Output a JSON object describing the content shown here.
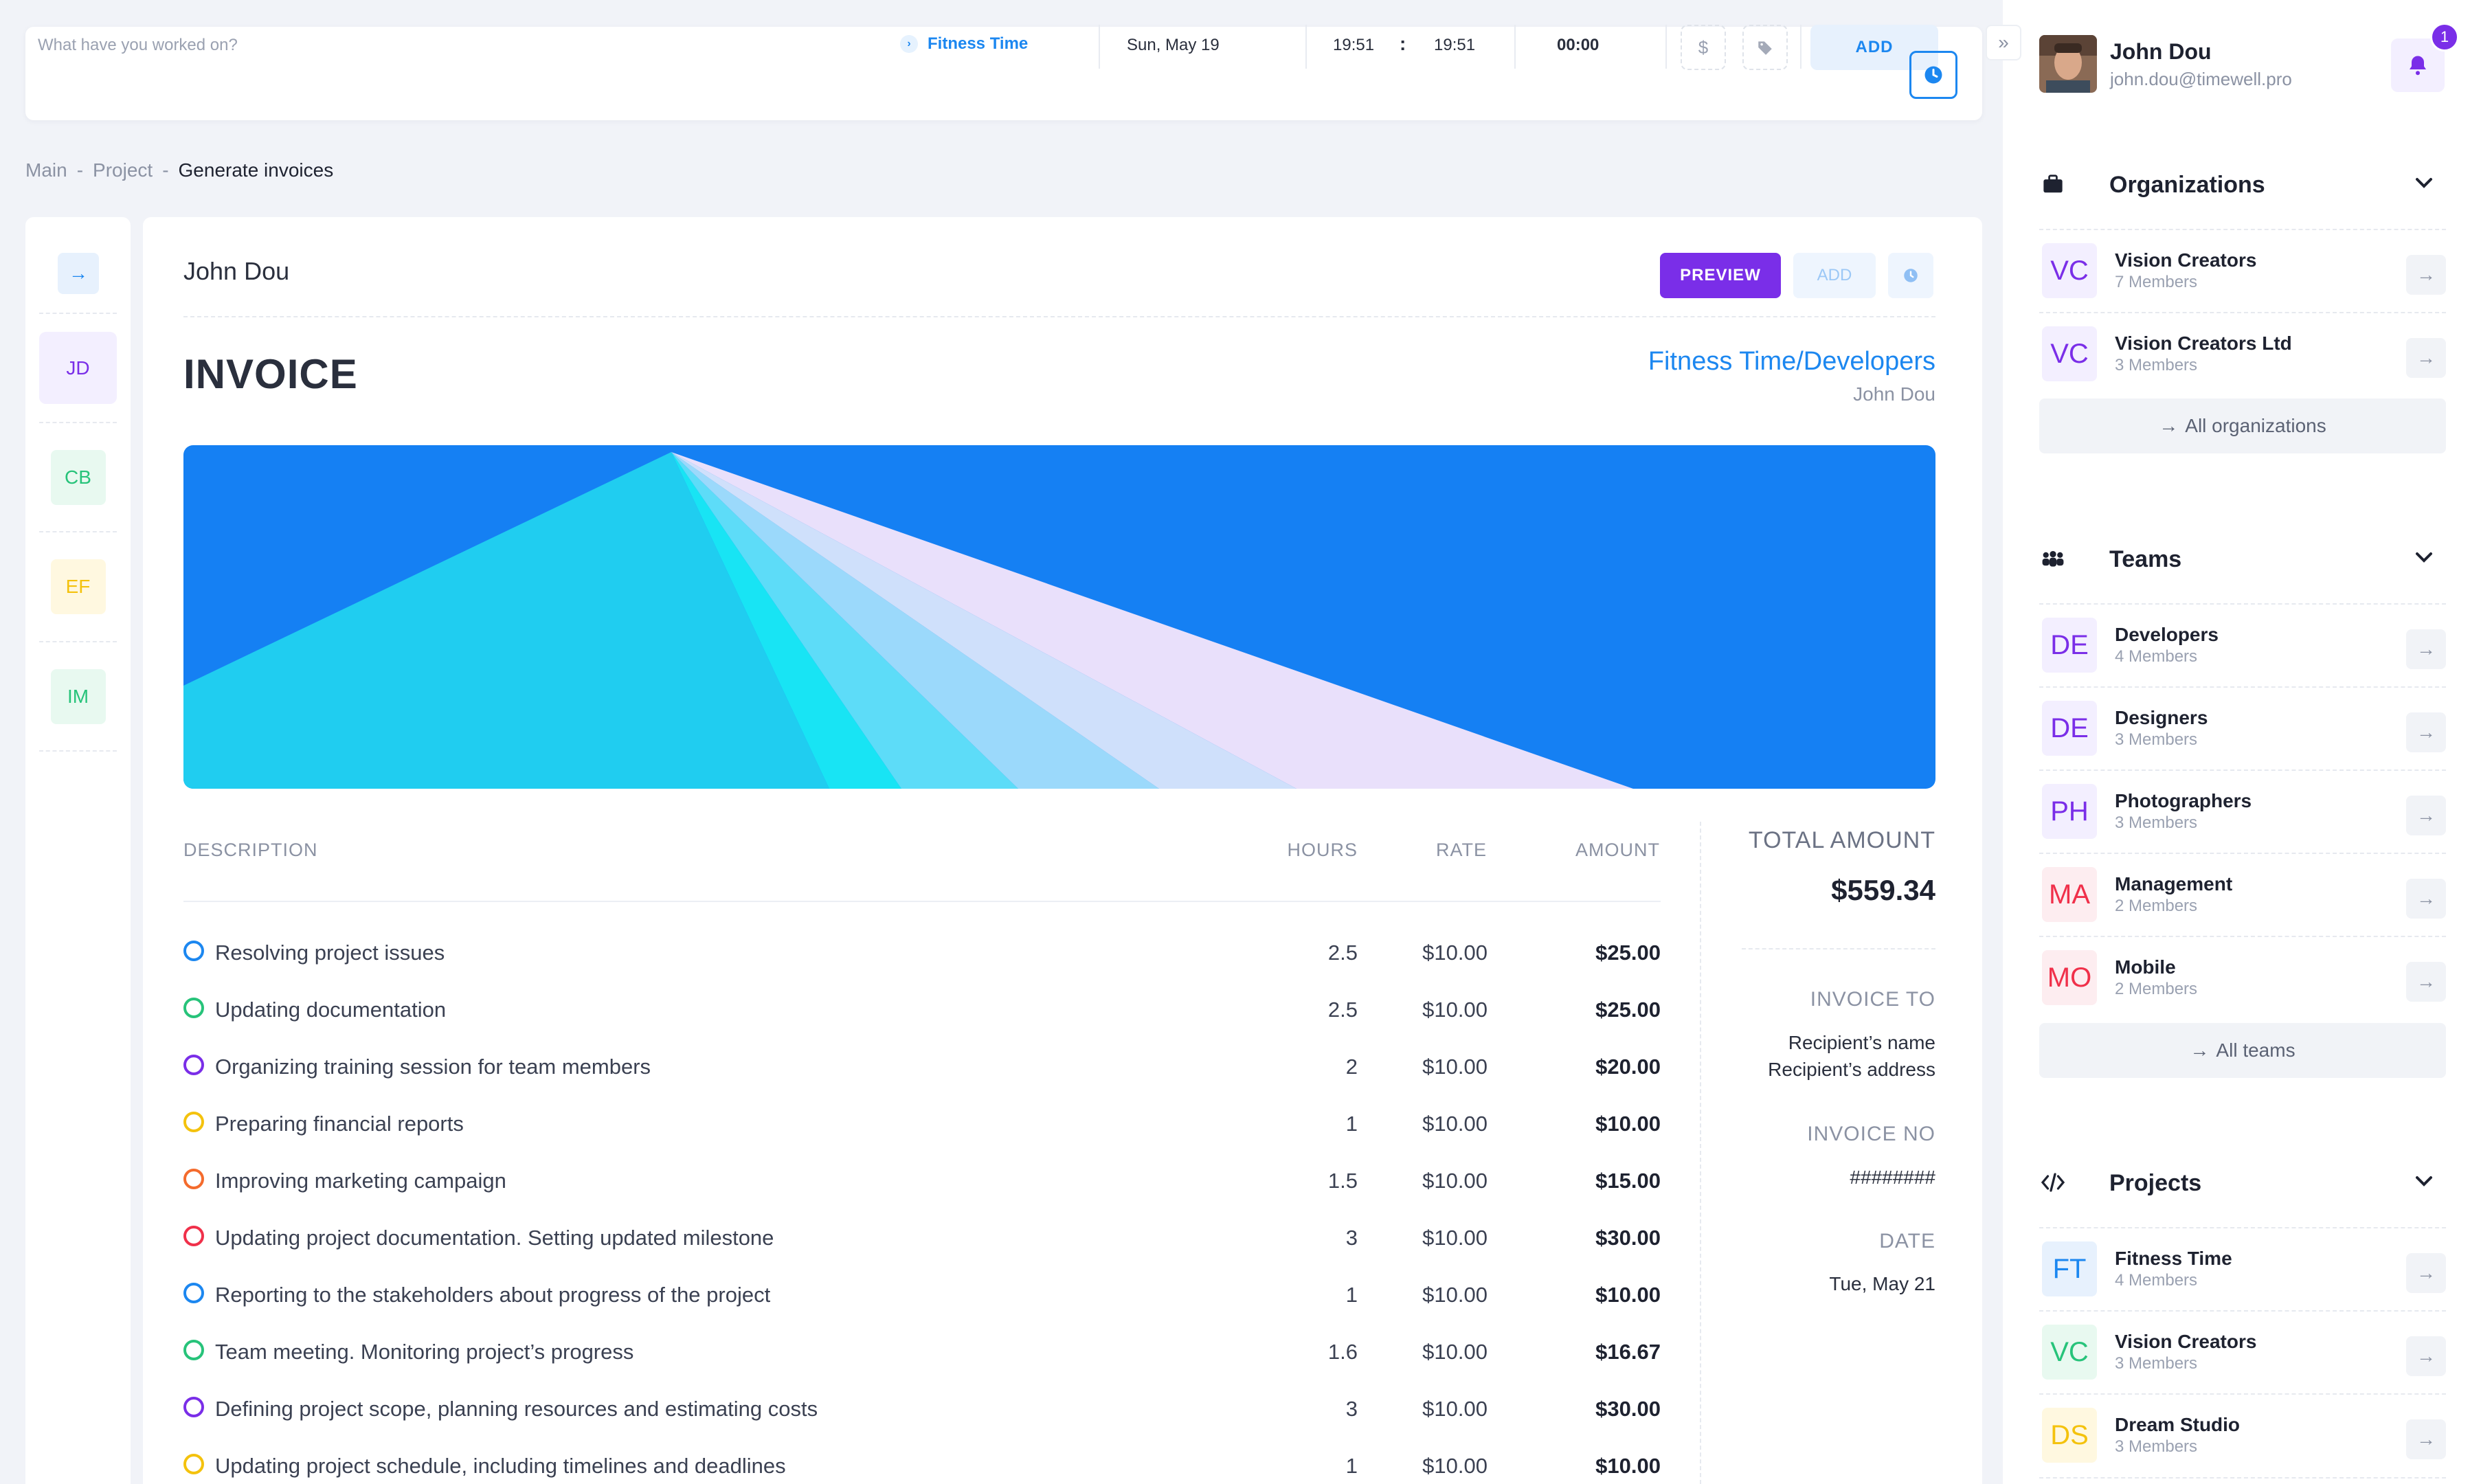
{
  "topbar": {
    "placeholder": "What have you worked on?",
    "project": "Fitness Time",
    "project_icon": "chevron-right-icon",
    "date": "Sun, May 19",
    "time_start": "19:51",
    "time_sep": ":",
    "time_end": "19:51",
    "duration": "00:00",
    "billable_symbol": "$",
    "tag_icon": "tag-icon",
    "add_label": "ADD",
    "clock_icon": "clock-icon"
  },
  "breadcrumb": {
    "items": [
      "Main",
      "Project",
      "Generate invoices"
    ],
    "separator": "-"
  },
  "rail": {
    "arrow_icon": "arrow-right-icon",
    "avatars": [
      {
        "initials": "JD",
        "color": "#7a2ee8",
        "bg": "#f3efff"
      },
      {
        "initials": "CB",
        "color": "#27c37a",
        "bg": "#e8f9f0"
      },
      {
        "initials": "EF",
        "color": "#f4c20d",
        "bg": "#fff8e0"
      },
      {
        "initials": "IM",
        "color": "#27c37a",
        "bg": "#e8f9f0"
      }
    ]
  },
  "invoice": {
    "owner": "John Dou",
    "preview_label": "PREVIEW",
    "add_label": "ADD",
    "title": "INVOICE",
    "company": "Fitness Time/Developers",
    "person": "John Dou",
    "headers": {
      "description": "DESCRIPTION",
      "hours": "HOURS",
      "rate": "RATE",
      "amount": "AMOUNT"
    },
    "rows": [
      {
        "description": "Resolving project issues",
        "hours": "2.5",
        "rate": "$10.00",
        "amount": "$25.00",
        "color": "#1c87f0"
      },
      {
        "description": "Updating documentation",
        "hours": "2.5",
        "rate": "$10.00",
        "amount": "$25.00",
        "color": "#27c37a"
      },
      {
        "description": "Organizing training session for team members",
        "hours": "2",
        "rate": "$10.00",
        "amount": "$20.00",
        "color": "#7a2ee8"
      },
      {
        "description": "Preparing financial reports",
        "hours": "1",
        "rate": "$10.00",
        "amount": "$10.00",
        "color": "#f4c20d"
      },
      {
        "description": "Improving marketing campaign",
        "hours": "1.5",
        "rate": "$10.00",
        "amount": "$15.00",
        "color": "#f46b2d"
      },
      {
        "description": "Updating project documentation. Setting updated milestone",
        "hours": "3",
        "rate": "$10.00",
        "amount": "$30.00",
        "color": "#f0304a"
      },
      {
        "description": "Reporting to the stakeholders about progress of the project",
        "hours": "1",
        "rate": "$10.00",
        "amount": "$10.00",
        "color": "#1c87f0"
      },
      {
        "description": "Team meeting. Monitoring project’s progress",
        "hours": "1.6",
        "rate": "$10.00",
        "amount": "$16.67",
        "color": "#27c37a"
      },
      {
        "description": "Defining project scope, planning resources and estimating costs",
        "hours": "3",
        "rate": "$10.00",
        "amount": "$30.00",
        "color": "#7a2ee8"
      },
      {
        "description": "Updating project schedule, including timelines and deadlines",
        "hours": "1",
        "rate": "$10.00",
        "amount": "$10.00",
        "color": "#f4c20d"
      }
    ],
    "total_label": "TOTAL AMOUNT",
    "total_value": "$559.34",
    "invoice_to_label": "INVOICE TO",
    "recipient_name": "Recipient’s name",
    "recipient_address": "Recipient’s address",
    "invoice_no_label": "INVOICE NO",
    "invoice_no": "########",
    "date_label": "DATE",
    "date": "Tue, May 21"
  },
  "user": {
    "name": "John Dou",
    "email": "john.dou@timewell.pro",
    "notifications": "1"
  },
  "organizations": {
    "title": "Organizations",
    "all_label": "All organizations",
    "items": [
      {
        "initials": "VC",
        "name": "Vision Creators",
        "members": "7 Members",
        "color": "#7a2ee8",
        "bg": "#f3efff"
      },
      {
        "initials": "VC",
        "name": "Vision Creators Ltd",
        "members": "3 Members",
        "color": "#7a2ee8",
        "bg": "#f3efff"
      }
    ]
  },
  "teams": {
    "title": "Teams",
    "all_label": "All teams",
    "items": [
      {
        "initials": "DE",
        "name": "Developers",
        "members": "4 Members",
        "color": "#7a2ee8",
        "bg": "#f3efff"
      },
      {
        "initials": "DE",
        "name": "Designers",
        "members": "3 Members",
        "color": "#7a2ee8",
        "bg": "#f3efff"
      },
      {
        "initials": "PH",
        "name": "Photographers",
        "members": "3 Members",
        "color": "#7a2ee8",
        "bg": "#f3efff"
      },
      {
        "initials": "MA",
        "name": "Management",
        "members": "2 Members",
        "color": "#f0304a",
        "bg": "#fdedf0"
      },
      {
        "initials": "MO",
        "name": "Mobile",
        "members": "2 Members",
        "color": "#f0304a",
        "bg": "#fdedf0"
      }
    ]
  },
  "projects": {
    "title": "Projects",
    "items": [
      {
        "initials": "FT",
        "name": "Fitness Time",
        "members": "4 Members",
        "color": "#1c87f0",
        "bg": "#e7f1fd"
      },
      {
        "initials": "VC",
        "name": "Vision Creators",
        "members": "3 Members",
        "color": "#27c37a",
        "bg": "#e8f9f0"
      },
      {
        "initials": "DS",
        "name": "Dream Studio",
        "members": "3 Members",
        "color": "#f4c20d",
        "bg": "#fff8e0"
      }
    ]
  },
  "colors": {
    "accent_blue": "#1c87f0",
    "accent_purple": "#7a2ee8",
    "background": "#f1f3f8"
  }
}
